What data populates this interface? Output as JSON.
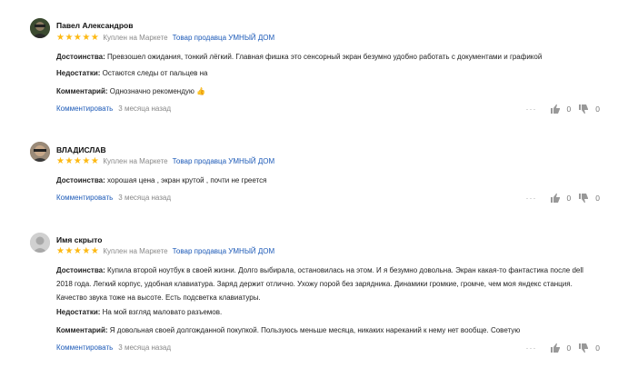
{
  "reviews": [
    {
      "author": "Павел Александров",
      "stars": "★★★★★",
      "bought": "Куплен на Маркете",
      "seller": "Товар продавца УМНЫЙ ДОМ",
      "pros_label": "Достоинства:",
      "pros": "Превзошел ожидания, тонкий лёгкий. Главная фишка это сенсорный экран безумно удобно работать с документами и графикой",
      "cons_label": "Недостатки:",
      "cons": "Остаются следы от пальцев на",
      "comment_label": "Комментарий:",
      "comment": "Однозначно рекомендую 👍",
      "comment_link": "Комментировать",
      "date": "3 месяца назад",
      "likes": "0",
      "dislikes": "0",
      "avatar_color": "#4a5a3a"
    },
    {
      "author": "ВЛАДИСЛАВ",
      "stars": "★★★★★",
      "bought": "Куплен на Маркете",
      "seller": "Товар продавца УМНЫЙ ДОМ",
      "pros_label": "Достоинства:",
      "pros": "хорошая цена , экран крутой , почти не греется",
      "comment_link": "Комментировать",
      "date": "3 месяца назад",
      "likes": "0",
      "dislikes": "0",
      "avatar_color": "#6b5a48"
    },
    {
      "author": "Имя скрыто",
      "stars": "★★★★★",
      "bought": "Куплен на Маркете",
      "seller": "Товар продавца УМНЫЙ ДОМ",
      "pros_label": "Достоинства:",
      "pros": "Купила второй ноутбук в своей жизни. Долго выбирала, остановилась на этом. И я безумно довольна. Экран какая-то фантастика после dell 2018 года. Легкий корпус, удобная клавиатура. Заряд держит отлично. Ухожу порой без зарядника. Динамики громкие, громче, чем моя яндекс станция. Качество звука тоже на высоте. Есть подсветка клавиатуры.",
      "cons_label": "Недостатки:",
      "cons": "На мой взгляд маловато разъемов.",
      "comment_label": "Комментарий:",
      "comment": "Я довольная своей долгожданной покупкой. Пользуюсь меньше месяца, никаких нареканий к нему нет вообще. Советую",
      "comment_link": "Комментировать",
      "date": "3 месяца назад",
      "likes": "0",
      "dislikes": "0",
      "avatar_color": "#c8c8c8"
    }
  ],
  "icons": {
    "more": "more-dots-icon",
    "like": "thumbs-up-icon",
    "dislike": "thumbs-down-icon"
  },
  "colors": {
    "star": "#fdb913",
    "link": "#1e5bb8",
    "muted": "#888888"
  }
}
